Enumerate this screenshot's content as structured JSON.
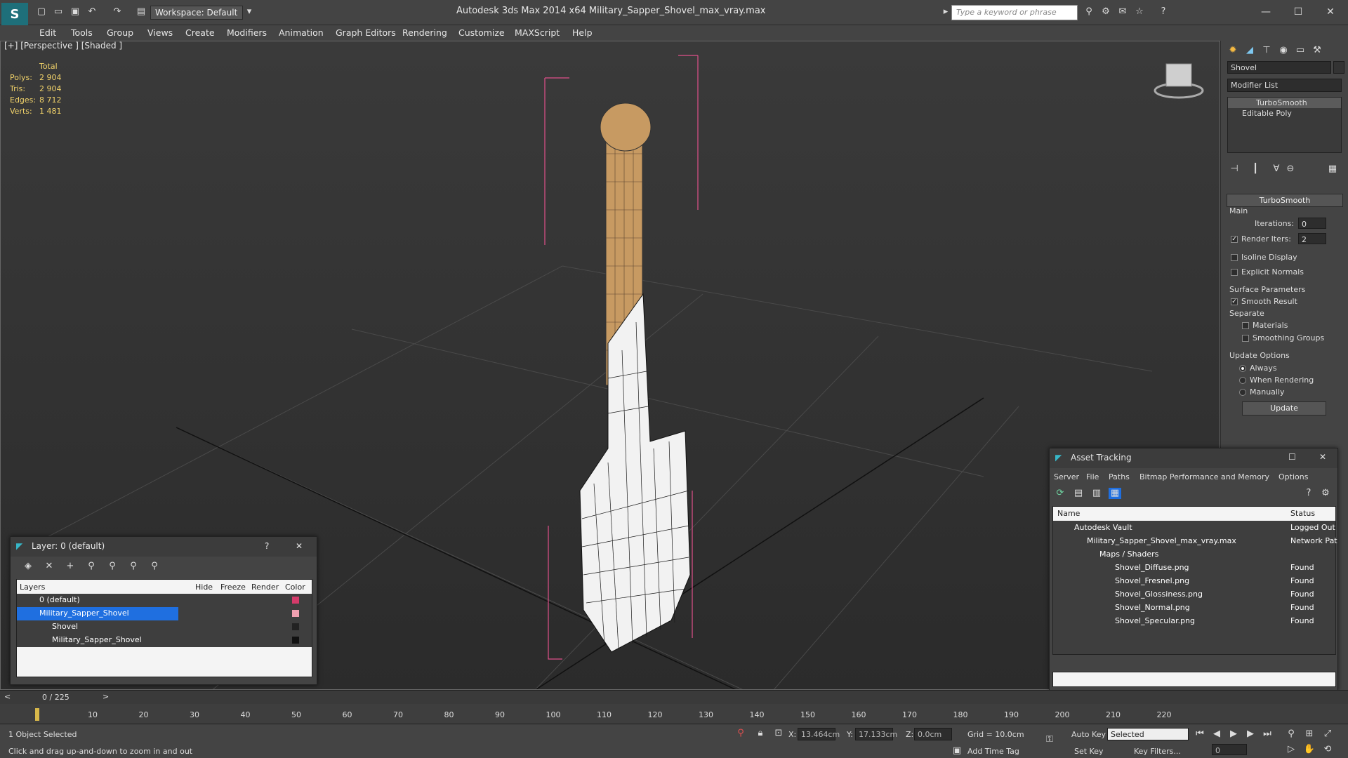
{
  "titlebar": {
    "workspace": "Workspace: Default",
    "title": "Autodesk 3ds Max  2014 x64      Military_Sapper_Shovel_max_vray.max",
    "search_placeholder": "Type a keyword or phrase",
    "minimize": "—",
    "maximize": "☐",
    "close": "✕"
  },
  "menu": [
    "Edit",
    "Tools",
    "Group",
    "Views",
    "Create",
    "Modifiers",
    "Animation",
    "Graph Editors",
    "Rendering",
    "Customize",
    "MAXScript",
    "Help"
  ],
  "viewport": {
    "label": "[+] [Perspective ] [Shaded ]",
    "stats": {
      "total": "Total",
      "rows": [
        {
          "label": "Polys:",
          "value": "2 904"
        },
        {
          "label": "Tris:",
          "value": "2 904"
        },
        {
          "label": "Edges:",
          "value": "8 712"
        },
        {
          "label": "Verts:",
          "value": "1 481"
        }
      ]
    }
  },
  "command_panel": {
    "object_name": "Shovel",
    "modifier_list": "Modifier List",
    "stack": [
      "TurboSmooth",
      "Editable Poly"
    ],
    "rollout_title": "TurboSmooth",
    "main": "Main",
    "iterations_label": "Iterations:",
    "iterations_value": "0",
    "render_iters_label": "Render Iters:",
    "render_iters_value": "2",
    "isoline": "Isoline Display",
    "explicit_normals": "Explicit Normals",
    "surface_params": "Surface Parameters",
    "smooth_result": "Smooth Result",
    "separate": "Separate",
    "materials": "Materials",
    "smoothing_groups": "Smoothing Groups",
    "update_options": "Update Options",
    "always": "Always",
    "when_rendering": "When Rendering",
    "manually": "Manually",
    "update_button": "Update"
  },
  "layer_dialog": {
    "title": "Layer: 0 (default)",
    "help": "?",
    "close": "✕",
    "columns": [
      "Layers",
      "Hide",
      "Freeze",
      "Render",
      "Color"
    ],
    "rows": [
      {
        "name": "0 (default)",
        "color": "#d43b6a"
      },
      {
        "name": "Military_Sapper_Shovel",
        "color": "#f0a0b0"
      },
      {
        "name": "Shovel",
        "color": "#222222"
      },
      {
        "name": "Military_Sapper_Shovel",
        "color": "#111111"
      }
    ]
  },
  "asset_dialog": {
    "title": "Asset Tracking",
    "menu": [
      "Server",
      "File",
      "Paths",
      "Bitmap Performance and Memory",
      "Options"
    ],
    "columns": [
      "Name",
      "Status"
    ],
    "rows": [
      {
        "name": "Autodesk Vault",
        "status": "Logged Out"
      },
      {
        "name": "Military_Sapper_Shovel_max_vray.max",
        "status": "Network Pat"
      },
      {
        "name": "Maps / Shaders",
        "status": ""
      },
      {
        "name": "Shovel_Diffuse.png",
        "status": "Found"
      },
      {
        "name": "Shovel_Fresnel.png",
        "status": "Found"
      },
      {
        "name": "Shovel_Glossiness.png",
        "status": "Found"
      },
      {
        "name": "Shovel_Normal.png",
        "status": "Found"
      },
      {
        "name": "Shovel_Specular.png",
        "status": "Found"
      }
    ]
  },
  "timeline": {
    "frame": "0 / 225",
    "ticks": [
      "10",
      "20",
      "30",
      "40",
      "50",
      "60",
      "70",
      "80",
      "90",
      "100",
      "110",
      "120",
      "130",
      "140",
      "150",
      "160",
      "170",
      "180",
      "190",
      "200",
      "210",
      "220"
    ]
  },
  "status": {
    "selection": "1 Object Selected",
    "prompt": "Click and drag up-and-down to zoom in and out",
    "x_label": "X:",
    "x_value": "13.464cm",
    "y_label": "Y:",
    "y_value": "17.133cm",
    "z_label": "Z:",
    "z_value": "0.0cm",
    "grid": "Grid = 10.0cm",
    "add_time_tag": "Add Time Tag",
    "auto_key": "Auto Key",
    "set_key": "Set Key",
    "selected": "Selected",
    "key_filters": "Key Filters...",
    "frame_field": "0"
  }
}
